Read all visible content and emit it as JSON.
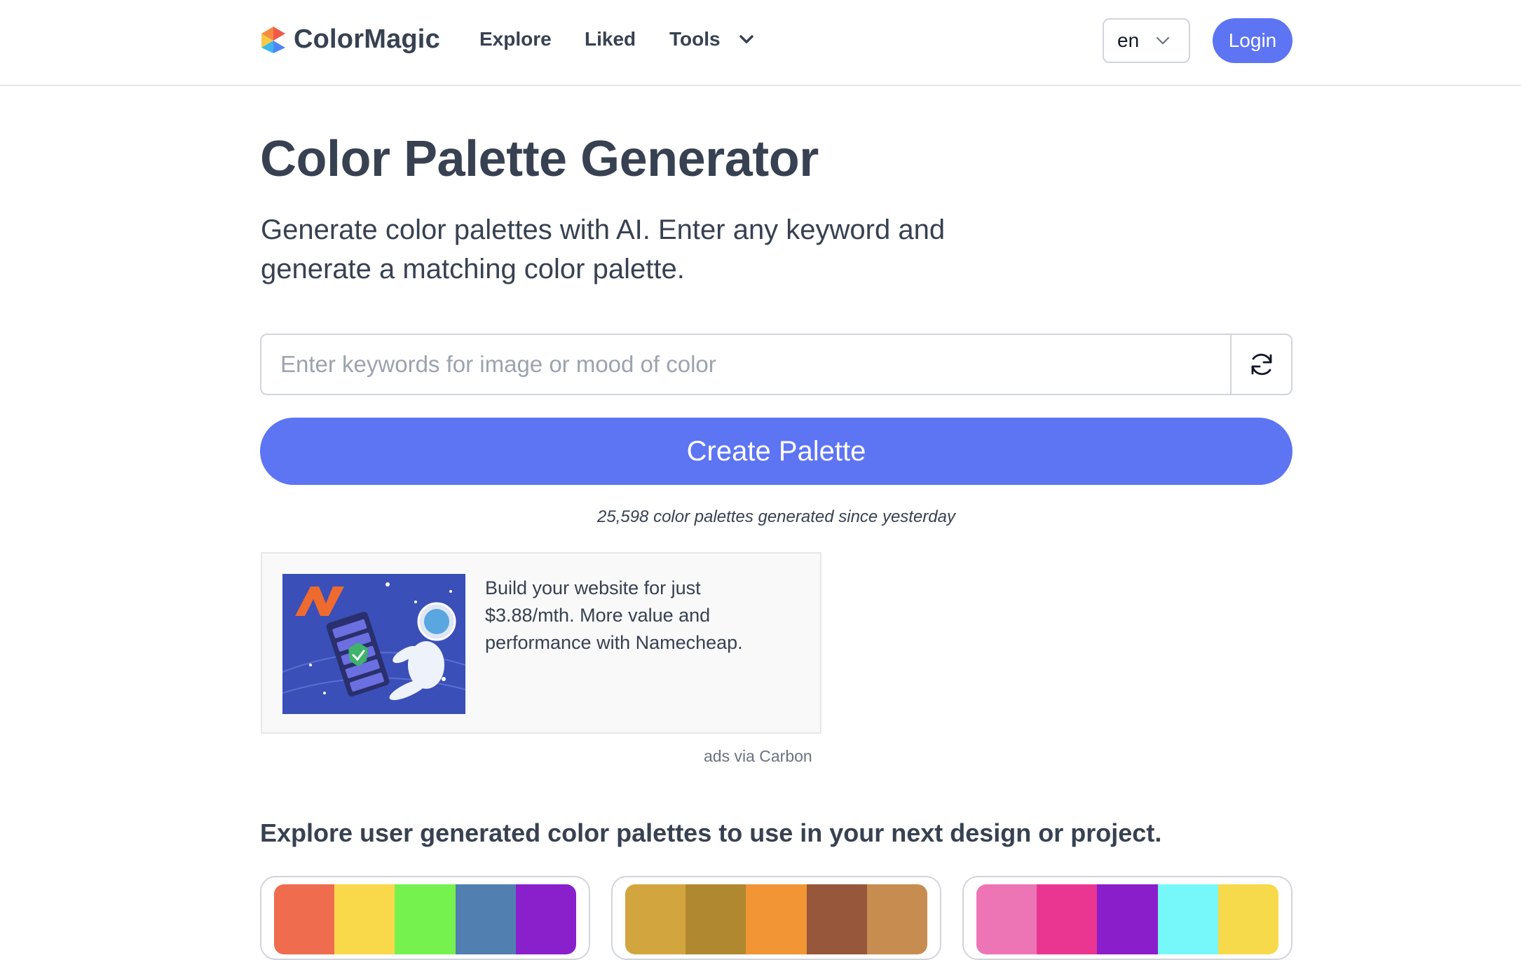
{
  "brand": {
    "name": "ColorMagic"
  },
  "nav": {
    "explore": "Explore",
    "liked": "Liked",
    "tools": "Tools"
  },
  "language": {
    "selected": "en"
  },
  "login": "Login",
  "hero": {
    "title": "Color Palette Generator",
    "subtitle_line1": "Generate color palettes with AI. Enter any keyword and",
    "subtitle_line2": "generate a matching color palette."
  },
  "search": {
    "placeholder": "Enter keywords for image or mood of color",
    "value": ""
  },
  "create_button": "Create Palette",
  "stats": "25,598 color palettes generated since yesterday",
  "ad": {
    "text": "Build your website for just $3.88/mth. More value and performance with Namecheap.",
    "via": "ads via Carbon"
  },
  "explore_heading": "Explore user generated color palettes to use in your next design or project.",
  "palettes": [
    {
      "colors": [
        "#ef6c4f",
        "#f9d84a",
        "#76f24f",
        "#507fb0",
        "#8a20cc"
      ]
    },
    {
      "colors": [
        "#d3a53f",
        "#b0882f",
        "#f29535",
        "#96573a",
        "#c78c4f"
      ]
    },
    {
      "colors": [
        "#ed75b6",
        "#ea3690",
        "#8b1ecb",
        "#76f8fa",
        "#f7d94c"
      ]
    }
  ],
  "accent_color": "#5d74f3"
}
